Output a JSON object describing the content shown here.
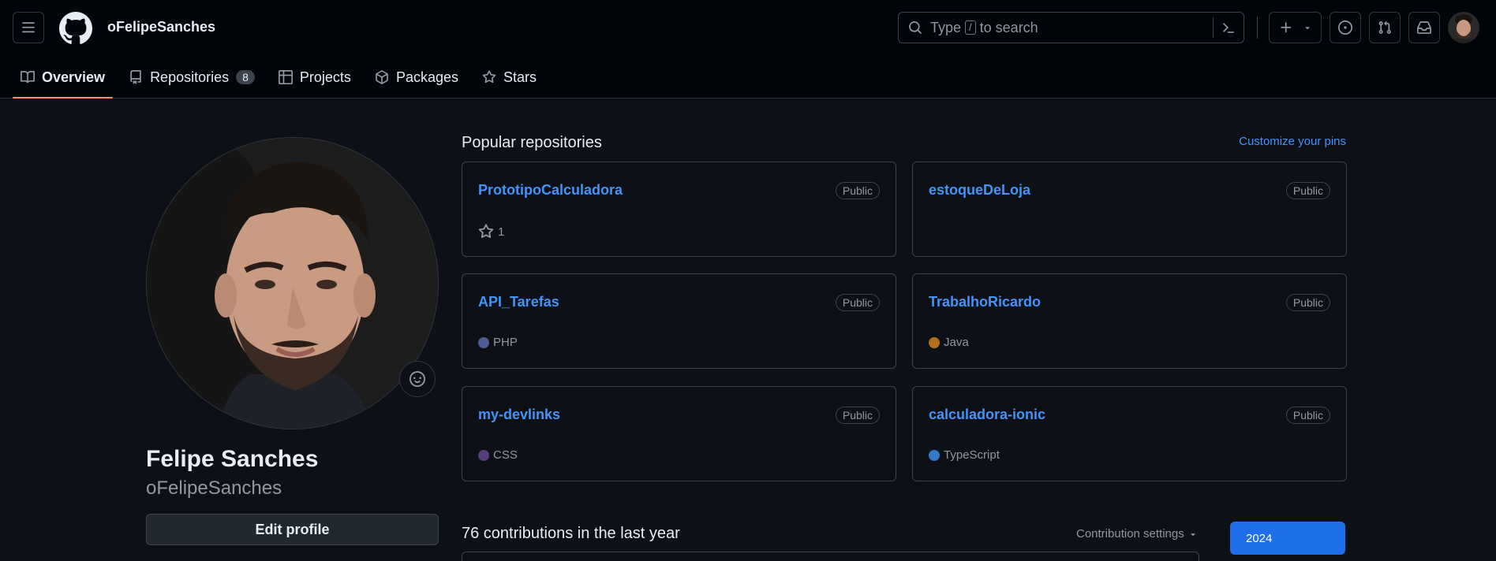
{
  "header": {
    "username": "oFelipeSanches",
    "search": {
      "prefix": "Type",
      "key": "/",
      "suffix": "to search"
    }
  },
  "tabs": [
    {
      "label": "Overview",
      "active": true,
      "icon": "book-icon"
    },
    {
      "label": "Repositories",
      "counter": "8",
      "icon": "repo-icon"
    },
    {
      "label": "Projects",
      "icon": "table-icon"
    },
    {
      "label": "Packages",
      "icon": "package-icon"
    },
    {
      "label": "Stars",
      "icon": "star-icon"
    }
  ],
  "profile": {
    "full_name": "Felipe Sanches",
    "login": "oFelipeSanches",
    "edit_label": "Edit profile"
  },
  "popular": {
    "title": "Popular repositories",
    "customize_label": "Customize your pins",
    "repos": [
      {
        "name": "PrototipoCalculadora",
        "visibility": "Public",
        "stars": "1"
      },
      {
        "name": "estoqueDeLoja",
        "visibility": "Public"
      },
      {
        "name": "API_Tarefas",
        "visibility": "Public",
        "language": "PHP",
        "language_color": "#4F5D95"
      },
      {
        "name": "TrabalhoRicardo",
        "visibility": "Public",
        "language": "Java",
        "language_color": "#b07219"
      },
      {
        "name": "my-devlinks",
        "visibility": "Public",
        "language": "CSS",
        "language_color": "#563d7c"
      },
      {
        "name": "calculadora-ionic",
        "visibility": "Public",
        "language": "TypeScript",
        "language_color": "#3178c6"
      }
    ]
  },
  "contributions": {
    "title": "76 contributions in the last year",
    "settings_label": "Contribution settings",
    "year": "2024"
  },
  "colors": {
    "accent_link": "#4493f8",
    "tab_underline": "#fd8c73",
    "year_button": "#1f6feb"
  }
}
